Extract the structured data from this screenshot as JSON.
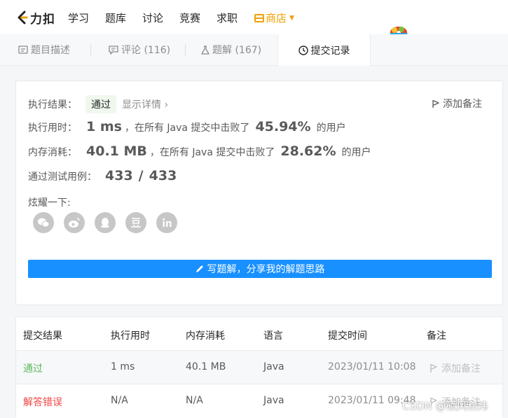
{
  "nav": {
    "logo_text": "力扣",
    "items": [
      "学习",
      "题库",
      "讨论",
      "竞赛",
      "求职"
    ],
    "shop": "商店"
  },
  "tabs": [
    {
      "label": "题目描述"
    },
    {
      "label": "评论 (116)"
    },
    {
      "label": "题解 (167)"
    },
    {
      "label": "提交记录"
    }
  ],
  "result": {
    "status_label": "执行结果：",
    "status_value": "通过",
    "detail_link": "显示详情",
    "add_note": "添加备注",
    "runtime": {
      "label": "执行用时：",
      "value": "1 ms",
      "middle": "，在所有 Java 提交中击败了",
      "percent": "45.94%",
      "suffix": "的用户"
    },
    "memory": {
      "label": "内存消耗：",
      "value": "40.1 MB",
      "middle": "，在所有 Java 提交中击败了",
      "percent": "28.62%",
      "suffix": "的用户"
    },
    "tests": {
      "label": "通过测试用例：",
      "passed": "433",
      "sep": "/",
      "total": "433"
    },
    "share_label": "炫耀一下:",
    "write_button": "写题解，分享我的解题思路"
  },
  "table": {
    "headers": [
      "提交结果",
      "执行用时",
      "内存消耗",
      "语言",
      "提交时间",
      "备注"
    ],
    "rows": [
      {
        "status": "通过",
        "time": "1 ms",
        "memory": "40.1 MB",
        "lang": "Java",
        "submitted": "2023/01/11 10:08",
        "note": "添加备注"
      },
      {
        "status": "解答错误",
        "time": "N/A",
        "memory": "N/A",
        "lang": "Java",
        "submitted": "2023/01/11 09:48",
        "note": "添加备注"
      }
    ]
  },
  "watermark": "CSDN @硕风和炜",
  "colors": {
    "accent": "#1890ff",
    "success": "#5cb85c",
    "error": "#f04545",
    "shop": "#f0a000"
  }
}
